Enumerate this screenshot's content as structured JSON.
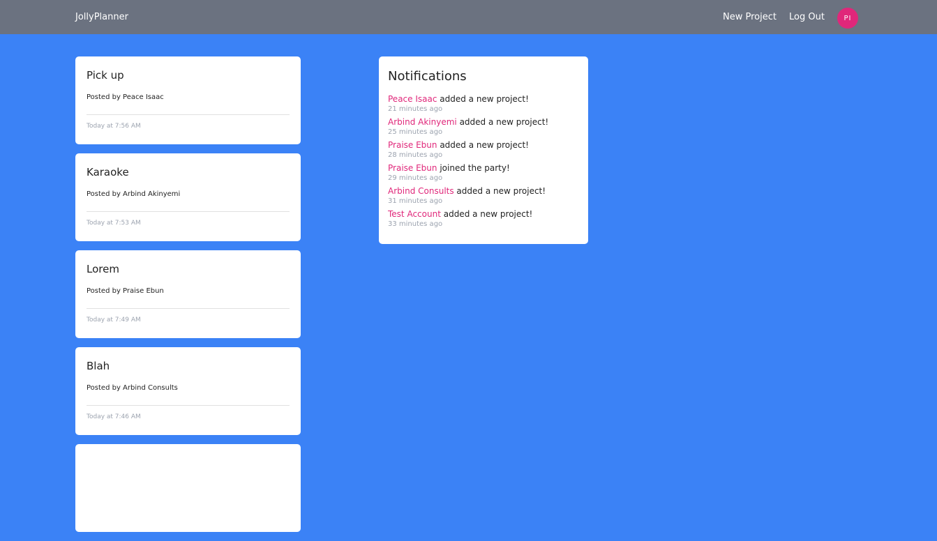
{
  "navbar": {
    "brand": "JollyPlanner",
    "new_project": "New Project",
    "logout": "Log Out",
    "avatar_initials": "PI",
    "avatar_color": "#e0277a"
  },
  "projects": [
    {
      "title": "Pick up",
      "author": "Posted by Peace Isaac",
      "date": "Today at 7:56 AM"
    },
    {
      "title": "Karaoke",
      "author": "Posted by Arbind Akinyemi",
      "date": "Today at 7:53 AM"
    },
    {
      "title": "Lorem",
      "author": "Posted by Praise Ebun",
      "date": "Today at 7:49 AM"
    },
    {
      "title": "Blah",
      "author": "Posted by Arbind Consults",
      "date": "Today at 7:46 AM"
    },
    {
      "title": "",
      "author": "",
      "date": ""
    }
  ],
  "notifications": {
    "title": "Notifications",
    "items": [
      {
        "user": "Peace Isaac",
        "action": " added a new project!",
        "time": "21 minutes ago"
      },
      {
        "user": "Arbind Akinyemi",
        "action": " added a new project!",
        "time": "25 minutes ago"
      },
      {
        "user": "Praise Ebun",
        "action": " added a new project!",
        "time": "28 minutes ago"
      },
      {
        "user": "Praise Ebun",
        "action": " joined the party!",
        "time": "29 minutes ago"
      },
      {
        "user": "Arbind Consults",
        "action": " added a new project!",
        "time": "31 minutes ago"
      },
      {
        "user": "Test Account",
        "action": " added a new project!",
        "time": "33 minutes ago"
      }
    ]
  },
  "colors": {
    "background": "#3b82f6",
    "navbar": "#6b7280",
    "accent": "#e0277a"
  }
}
